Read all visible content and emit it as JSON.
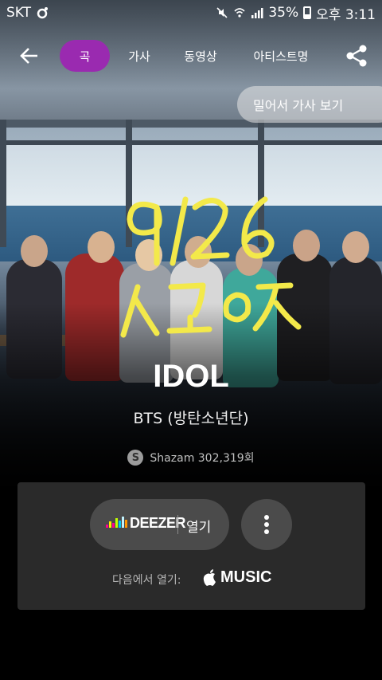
{
  "status_bar": {
    "carrier": "SKT",
    "battery_percent": "35%",
    "time": "오후 3:11"
  },
  "toolbar": {
    "tabs": [
      {
        "label": "곡",
        "active": true
      },
      {
        "label": "가사",
        "active": false
      },
      {
        "label": "동영상",
        "active": false
      },
      {
        "label": "아티스트명",
        "active": false
      }
    ],
    "back_icon": "arrow-left-icon",
    "share_icon": "share-icon"
  },
  "swipe_hint": "밀어서 가사 보기",
  "handwriting": {
    "line1": "9/26",
    "line2": "스고즈",
    "color": "#f3e94a"
  },
  "song": {
    "title": "IDOL",
    "artist": "BTS (방탄소년단)"
  },
  "shazam": {
    "text": "Shazam 302,319회",
    "icon": "shazam-icon"
  },
  "card": {
    "deezer_brand": "DEEZER",
    "deezer_open": "열기",
    "more_icon": "more-vertical-icon",
    "open_in_label": "다음에서 열기:",
    "apple_music_label": "MUSIC"
  },
  "colors": {
    "accent": "#9a2ab0",
    "card_bg": "#2a2a2a",
    "button_bg": "#4b4b4b"
  }
}
